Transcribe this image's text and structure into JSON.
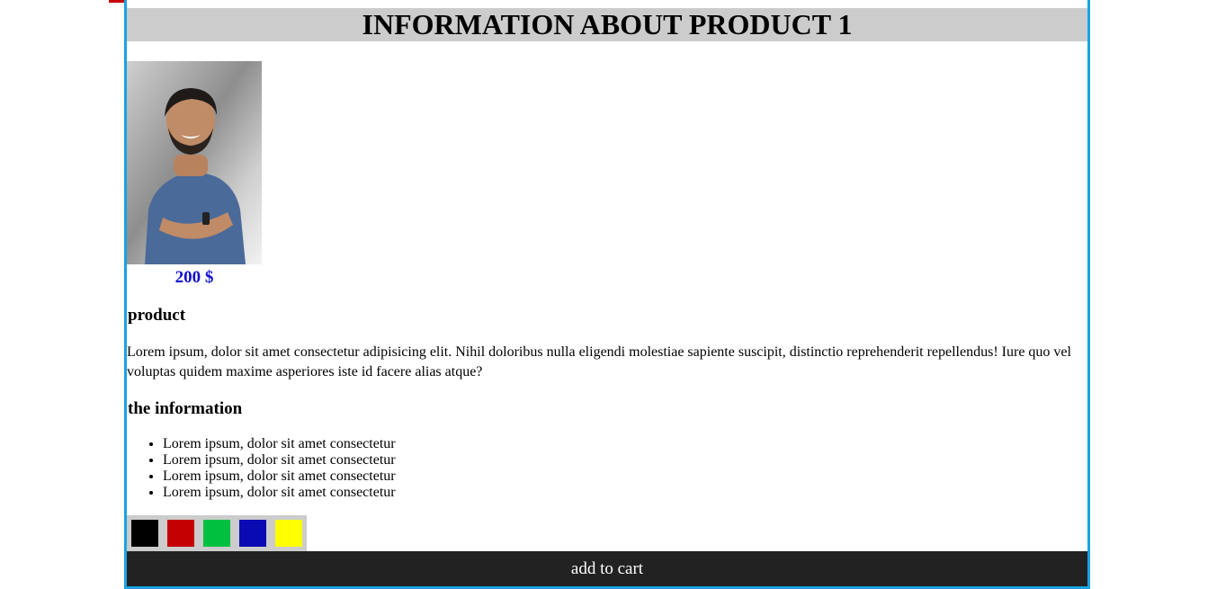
{
  "page": {
    "title": "INFORMATION ABOUT PRODUCT 1"
  },
  "product": {
    "price": "200 $",
    "price_color": "#1010d0",
    "heading": "product",
    "description": "Lorem ipsum, dolor sit amet consectetur adipisicing elit. Nihil doloribus nulla eligendi molestiae sapiente suscipit, distinctio reprehenderit repellendus! Iure quo vel voluptas quidem maxime asperiores iste id facere alias atque?"
  },
  "information": {
    "heading": "the information",
    "items": [
      "Lorem ipsum, dolor sit amet consectetur",
      "Lorem ipsum, dolor sit amet consectetur",
      "Lorem ipsum, dolor sit amet consectetur",
      "Lorem ipsum, dolor sit amet consectetur"
    ]
  },
  "colors": {
    "options": [
      {
        "name": "black",
        "hex": "#000000"
      },
      {
        "name": "red",
        "hex": "#c40000"
      },
      {
        "name": "green",
        "hex": "#00c040"
      },
      {
        "name": "blue",
        "hex": "#0a0ab4"
      },
      {
        "name": "yellow",
        "hex": "#ffff00"
      }
    ]
  },
  "cart": {
    "label": "add to cart"
  },
  "theme": {
    "card_border": "#1aa3e0",
    "title_bg": "#cccccc",
    "cart_bg": "#222222",
    "top_tab": "#c40000"
  }
}
